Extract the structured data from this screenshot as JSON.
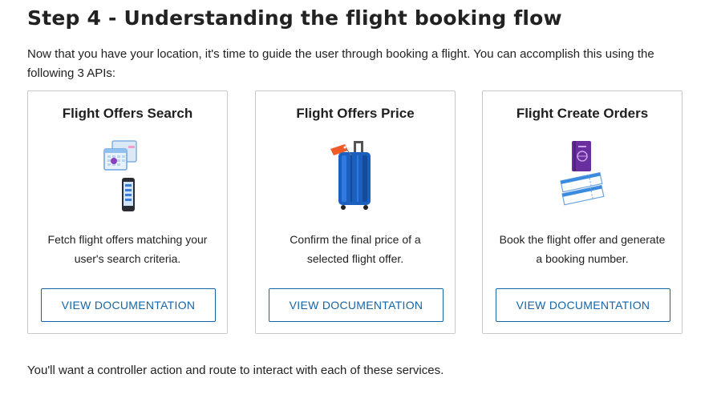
{
  "page": {
    "title": "Step 4 - Understanding the flight booking flow",
    "intro": "Now that you have your location, it's time to guide the user through booking a flight. You can accomplish this using the following 3 APIs:",
    "outro": "You'll want a controller action and route to interact with each of these services."
  },
  "cards": [
    {
      "title": "Flight Offers Search",
      "icon": "search-calendar-phone-icon",
      "description": "Fetch flight offers matching your user's search criteria.",
      "button": "VIEW DOCUMENTATION"
    },
    {
      "title": "Flight Offers Price",
      "icon": "luggage-price-tag-icon",
      "description": "Confirm the final price of a selected flight offer.",
      "button": "VIEW DOCUMENTATION"
    },
    {
      "title": "Flight Create Orders",
      "icon": "passport-ticket-icon",
      "description": "Book the flight offer and generate a booking number.",
      "button": "VIEW DOCUMENTATION"
    }
  ],
  "colors": {
    "accent": "#1565a8",
    "border": "#c9c9c9",
    "text": "#222222"
  }
}
